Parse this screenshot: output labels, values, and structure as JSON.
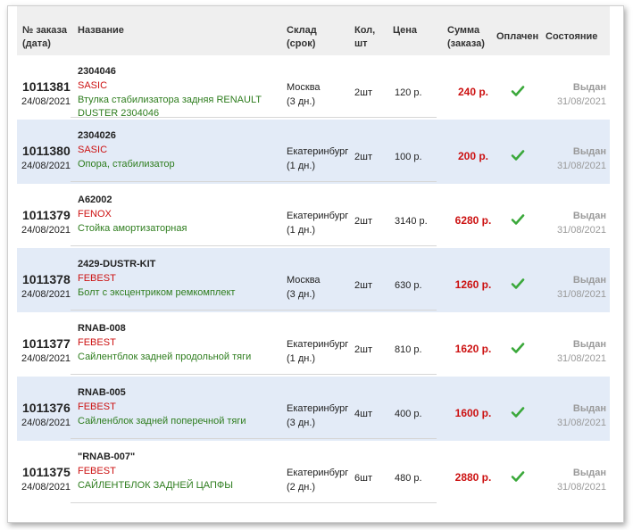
{
  "headers": {
    "order": "№ заказа",
    "order_sub": "(дата)",
    "name": "Название",
    "warehouse": "Склад",
    "warehouse_sub": "(срок)",
    "qty": "Кол,",
    "qty_sub": "шт",
    "price": "Цена",
    "sum": "Сумма",
    "sum_sub": "(заказа)",
    "paid": "Оплачен",
    "status": "Состояние"
  },
  "rows": [
    {
      "order": "1011381",
      "date": "24/08/2021",
      "article": "2304046",
      "brand": "SASIC",
      "name": "Втулка стабилизатора задняя RENAULT DUSTER 2304046",
      "warehouse": "Москва",
      "term": "(3 дн.)",
      "qty": "2шт",
      "price": "120 р.",
      "sum": "240 р.",
      "paid_icon": "check-icon",
      "status": "Выдан",
      "status_date": "31/08/2021"
    },
    {
      "order": "1011380",
      "date": "24/08/2021",
      "article": "2304026",
      "brand": "SASIC",
      "name": "Опора, стабилизатор",
      "warehouse": "Екатеринбург",
      "term": "(1 дн.)",
      "qty": "2шт",
      "price": "100 р.",
      "sum": "200 р.",
      "paid_icon": "check-icon",
      "status": "Выдан",
      "status_date": "31/08/2021"
    },
    {
      "order": "1011379",
      "date": "24/08/2021",
      "article": "A62002",
      "brand": "FENOX",
      "name": "Стойка амортизаторная",
      "warehouse": "Екатеринбург",
      "term": "(1 дн.)",
      "qty": "2шт",
      "price": "3140 р.",
      "sum": "6280 р.",
      "paid_icon": "check-icon",
      "status": "Выдан",
      "status_date": "31/08/2021"
    },
    {
      "order": "1011378",
      "date": "24/08/2021",
      "article": "2429-DUSTR-KIT",
      "brand": "FEBEST",
      "name": "Болт с эксцентриком ремкомплект",
      "warehouse": "Москва",
      "term": "(3 дн.)",
      "qty": "2шт",
      "price": "630 р.",
      "sum": "1260 р.",
      "paid_icon": "check-icon",
      "status": "Выдан",
      "status_date": "31/08/2021"
    },
    {
      "order": "1011377",
      "date": "24/08/2021",
      "article": "RNAB-008",
      "brand": "FEBEST",
      "name": "Сайлентблок задней продольной тяги",
      "warehouse": "Екатеринбург",
      "term": "(1 дн.)",
      "qty": "2шт",
      "price": "810 р.",
      "sum": "1620 р.",
      "paid_icon": "check-icon",
      "status": "Выдан",
      "status_date": "31/08/2021"
    },
    {
      "order": "1011376",
      "date": "24/08/2021",
      "article": "RNAB-005",
      "brand": "FEBEST",
      "name": "Сайленблок задней поперечной тяги",
      "warehouse": "Екатеринбург",
      "term": "(3 дн.)",
      "qty": "4шт",
      "price": "400 р.",
      "sum": "1600 р.",
      "paid_icon": "check-icon",
      "status": "Выдан",
      "status_date": "31/08/2021"
    },
    {
      "order": "1011375",
      "date": "24/08/2021",
      "article": "\"RNAB-007\"",
      "brand": "FEBEST",
      "name": "САЙЛЕНТБЛОК ЗАДНЕЙ ЦАПФЫ",
      "warehouse": "Екатеринбург",
      "term": "(2 дн.)",
      "qty": "6шт",
      "price": "480 р.",
      "sum": "2880 р.",
      "paid_icon": "check-icon",
      "status": "Выдан",
      "status_date": "31/08/2021"
    }
  ],
  "colors": {
    "brand": "#cc1111",
    "name": "#2e7d1e",
    "sum": "#cc1111",
    "check": "#3aa83a",
    "alt_row": "#e3ebf7",
    "status": "#9a9a9a"
  }
}
